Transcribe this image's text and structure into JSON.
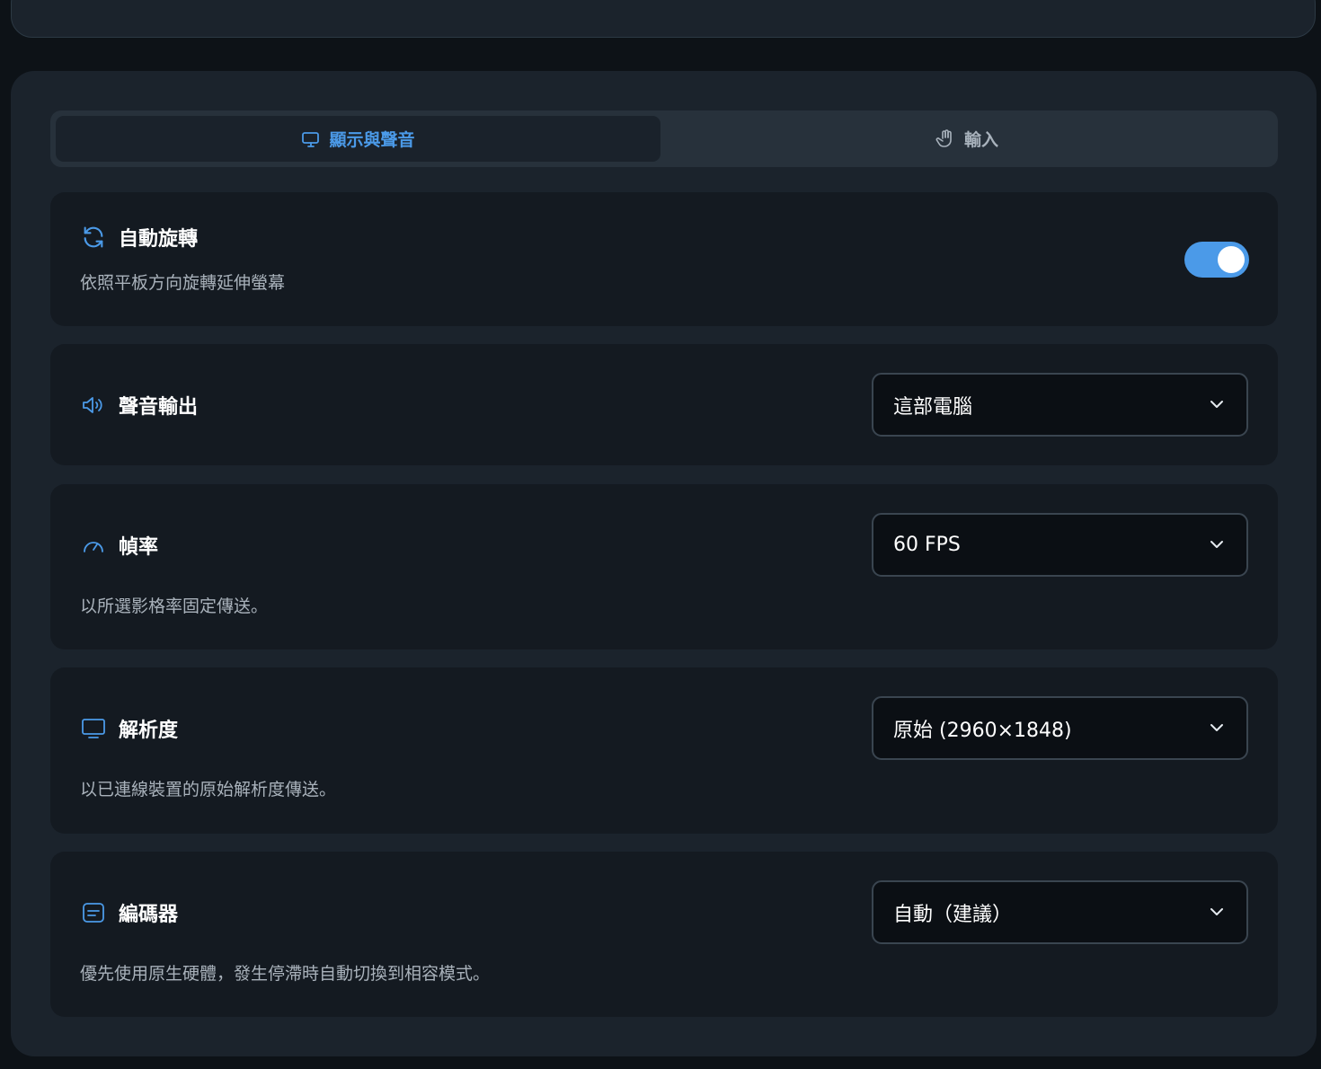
{
  "tabs": [
    {
      "label": "顯示與聲音",
      "icon": "monitor-icon",
      "active": true
    },
    {
      "label": "輸入",
      "icon": "hand-pointer-icon",
      "active": false
    }
  ],
  "settings": {
    "auto_rotate": {
      "title": "自動旋轉",
      "description": "依照平板方向旋轉延伸螢幕",
      "icon": "refresh-icon",
      "enabled": true
    },
    "audio_output": {
      "title": "聲音輸出",
      "icon": "speaker-icon",
      "value": "這部電腦"
    },
    "frame_rate": {
      "title": "幀率",
      "description": "以所選影格率固定傳送。",
      "icon": "gauge-icon",
      "value": "60 FPS"
    },
    "resolution": {
      "title": "解析度",
      "description": "以已連線裝置的原始解析度傳送。",
      "icon": "monitor-icon",
      "value": "原始 (2960×1848)"
    },
    "encoder": {
      "title": "編碼器",
      "description": "優先使用原生硬體，發生停滯時自動切換到相容模式。",
      "icon": "encoder-icon",
      "value": "自動（建議）"
    }
  },
  "colors": {
    "accent": "#4b9ae8",
    "background": "#0d1217",
    "panel": "#1b232c",
    "card": "#141a21"
  }
}
